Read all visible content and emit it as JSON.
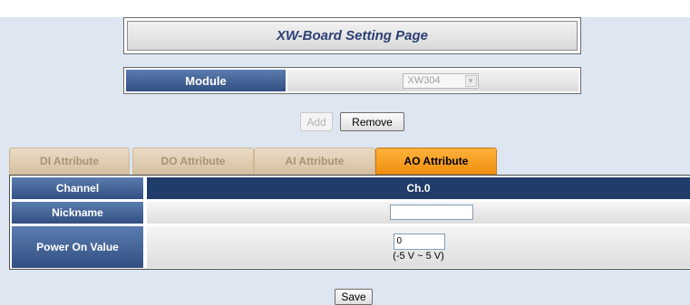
{
  "page": {
    "title": "XW-Board Setting Page"
  },
  "module": {
    "label": "Module",
    "selected": "XW304",
    "dropdown_arrow": "chevron-down-icon"
  },
  "actions": {
    "add_label": "Add",
    "remove_label": "Remove",
    "save_label": "Save"
  },
  "tabs": [
    {
      "label": "DI Attribute",
      "active": false
    },
    {
      "label": "DO Attribute",
      "active": false
    },
    {
      "label": "AI Attribute",
      "active": false
    },
    {
      "label": "AO Attribute",
      "active": true
    }
  ],
  "table": {
    "channel_label": "Channel",
    "channel_value": "Ch.0",
    "nickname_label": "Nickname",
    "nickname_value": "",
    "power_on_label": "Power On Value",
    "power_on_value": "0",
    "power_on_range": "(-5 V ~ 5 V)"
  },
  "colors": {
    "header_blue": "#324f82",
    "channel_row": "#203c69",
    "active_tab": "#f39a1e",
    "inactive_tab": "#e3d1b6",
    "page_background": "#dde6f1"
  }
}
